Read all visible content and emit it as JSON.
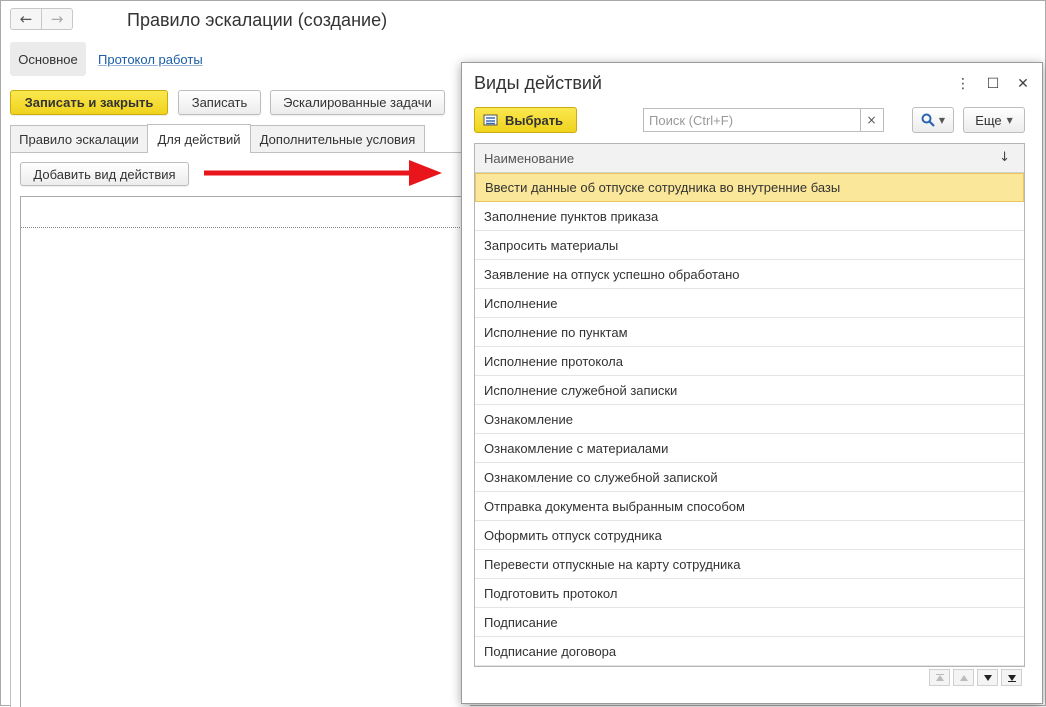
{
  "window": {
    "title": "Правило эскалации (создание)",
    "nav_back": "←",
    "nav_forward": "→"
  },
  "sections": {
    "main": "Основное",
    "log_link": "Протокол работы"
  },
  "toolbar": {
    "save_close": "Записать и закрыть",
    "save": "Записать",
    "escalated_tasks": "Эскалированные задачи"
  },
  "tabs": [
    {
      "label": "Правило эскалации",
      "active": false
    },
    {
      "label": "Для действий",
      "active": true
    },
    {
      "label": "Дополнительные условия",
      "active": false
    }
  ],
  "tab_content": {
    "add_action_button": "Добавить вид действия"
  },
  "dialog": {
    "title": "Виды действий",
    "menu_icon": "⋮",
    "maximize_icon": "☐",
    "close_icon": "✕",
    "select_button": "Выбрать",
    "search_placeholder": "Поиск (Ctrl+F)",
    "search_clear": "×",
    "more_button": "Еще",
    "column_header": "Наименование",
    "sort_icon": "↓",
    "items": [
      "Ввести данные об отпуске сотрудника во внутренние базы",
      "Заполнение пунктов приказа",
      "Запросить материалы",
      "Заявление на отпуск успешно обработано",
      "Исполнение",
      "Исполнение по пунктам",
      "Исполнение протокола",
      "Исполнение служебной записки",
      "Ознакомление",
      "Ознакомление с материалами",
      "Ознакомление со служебной запиской",
      "Отправка документа выбранным способом",
      "Оформить отпуск сотрудника",
      "Перевести отпускные на карту сотрудника",
      "Подготовить протокол",
      "Подписание",
      "Подписание договора"
    ],
    "selected_index": 0
  },
  "colors": {
    "accent_yellow": "#f5dc2e",
    "selected_row": "#fbe79a",
    "link": "#1c5ea8",
    "arrow": "#e8161b"
  }
}
